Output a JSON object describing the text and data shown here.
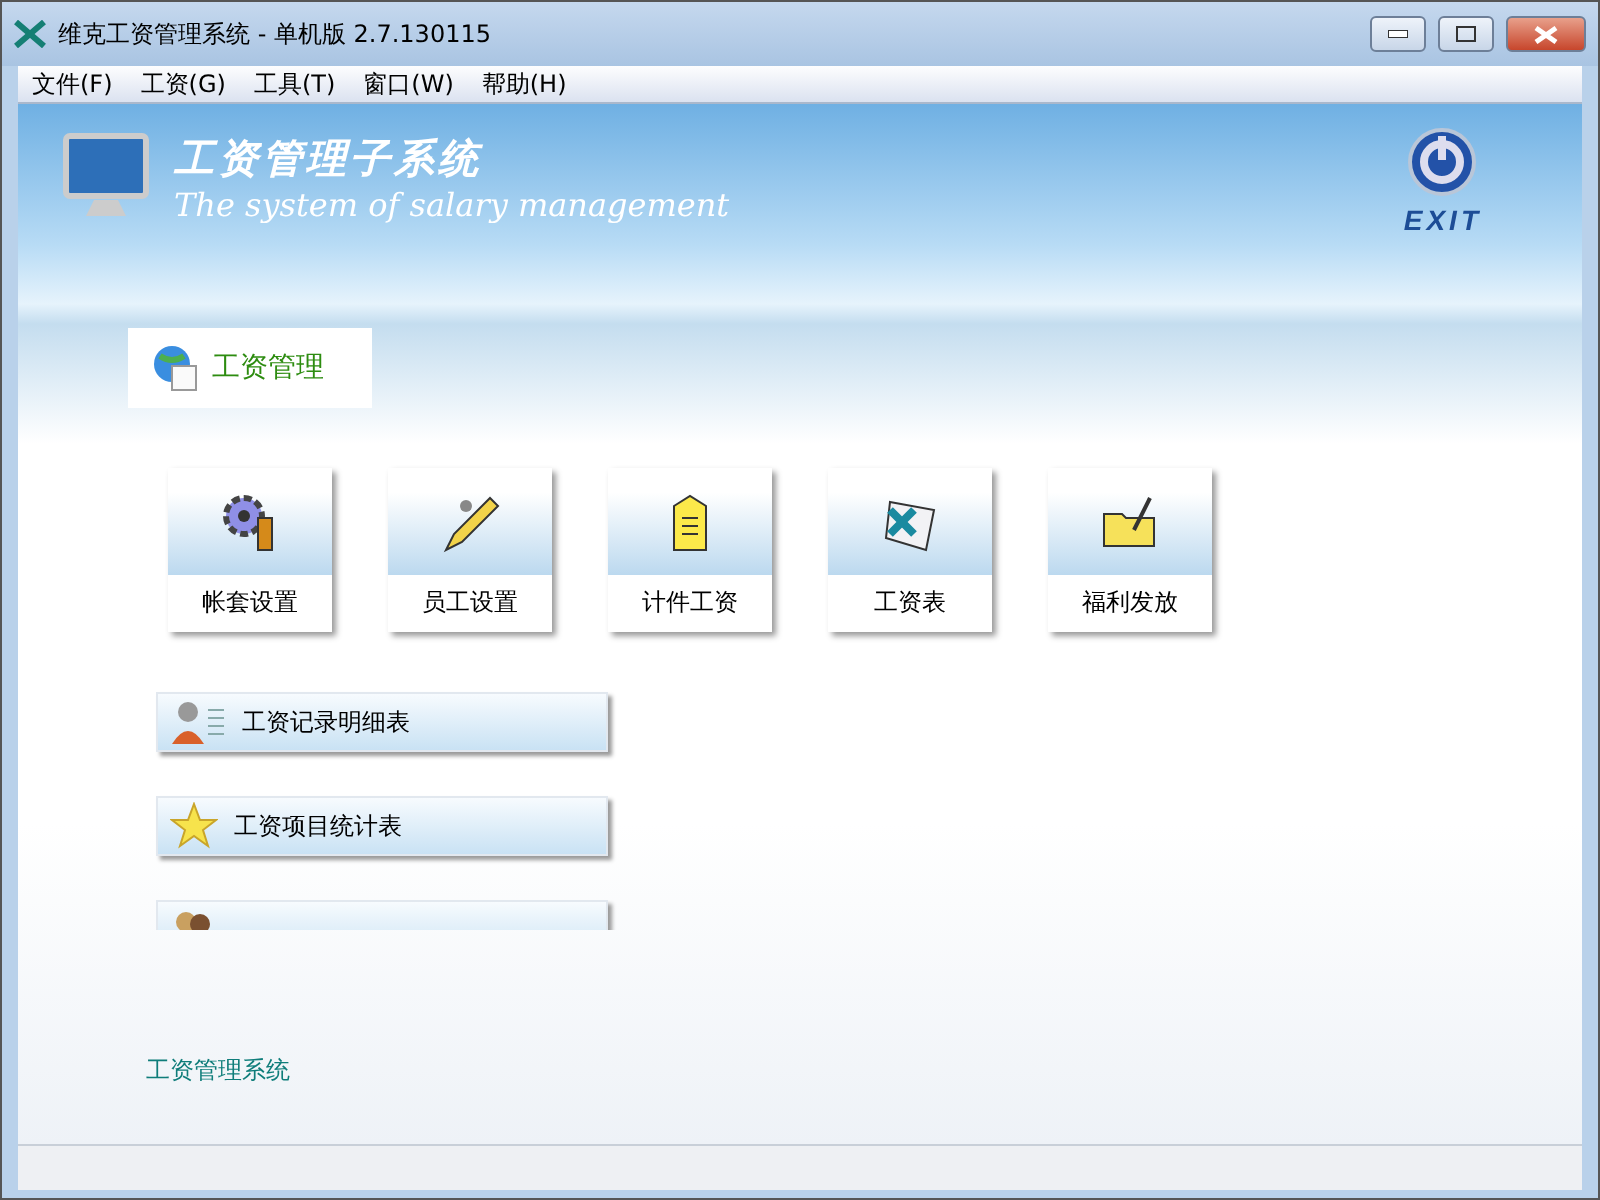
{
  "window": {
    "title": "维克工资管理系统 - 单机版 2.7.130115"
  },
  "menu": [
    "文件(F)",
    "工资(G)",
    "工具(T)",
    "窗口(W)",
    "帮助(H)"
  ],
  "banner": {
    "title": "工资管理子系统",
    "subtitle": "The system of salary management",
    "exit": "EXIT"
  },
  "tabs": [
    {
      "label": "工资管理",
      "selected": true
    }
  ],
  "modules": [
    {
      "label": "帐套设置",
      "kind": "gear"
    },
    {
      "label": "员工设置",
      "kind": "pencil"
    },
    {
      "label": "计件工资",
      "kind": "tag"
    },
    {
      "label": "工资表",
      "kind": "sheet"
    },
    {
      "label": "福利发放",
      "kind": "folder"
    }
  ],
  "reports": [
    {
      "label": "工资记录明细表",
      "kind": "person"
    },
    {
      "label": "工资项目统计表",
      "kind": "star"
    }
  ],
  "footer_link": "工资管理系统"
}
